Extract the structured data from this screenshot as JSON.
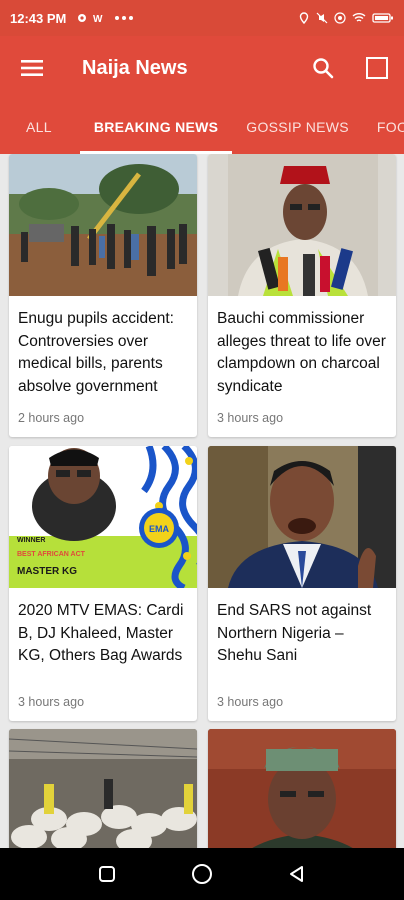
{
  "status_bar": {
    "time": "12:43 PM",
    "left_icons": [
      "gear-icon",
      "wifi-calling-icon",
      "more-dots-icon"
    ],
    "right_icons": [
      "location-icon",
      "mute-icon",
      "hotspot-icon",
      "wifi-icon",
      "battery-icon"
    ]
  },
  "app_bar": {
    "title": "Naija News",
    "menu_icon": "hamburger-icon",
    "search_icon": "search-icon",
    "action_icon": "square-icon"
  },
  "tabs": [
    {
      "label": "ALL",
      "active": false
    },
    {
      "label": "BREAKING NEWS",
      "active": true
    },
    {
      "label": "GOSSIP NEWS",
      "active": false
    },
    {
      "label": "FOO",
      "active": false
    }
  ],
  "cards": [
    {
      "title": "Enugu pupils accident: Controversies over medical bills, parents absolve government",
      "time": "2 hours ago",
      "image": "crowd-accident-scene"
    },
    {
      "title": "Bauchi commissioner alleges threat to life over clampdown on charcoal syndicate",
      "time": "3 hours ago",
      "image": "man-red-cap-microphones"
    },
    {
      "title": "2020 MTV EMAS: Cardi B, DJ Khaleed, Master KG, Others Bag Awards",
      "time": "3 hours ago",
      "image": "mtv-ema-winner-master-kg",
      "image_text": {
        "line1": "WINNER",
        "line2": "BEST AFRICAN ACT",
        "line3": "MASTER KG",
        "badge": "EMA"
      }
    },
    {
      "title": "End SARS not against Northern Nigeria – Shehu Sani",
      "time": "3 hours ago",
      "image": "man-speaking-portrait"
    },
    {
      "title": "",
      "time": "",
      "image": "warehouse-sacks"
    },
    {
      "title": "",
      "time": "",
      "image": "man-green-cap"
    }
  ],
  "colors": {
    "primary": "#e04a3b",
    "status_bar": "#d94a38",
    "background": "#e9e9e9"
  }
}
